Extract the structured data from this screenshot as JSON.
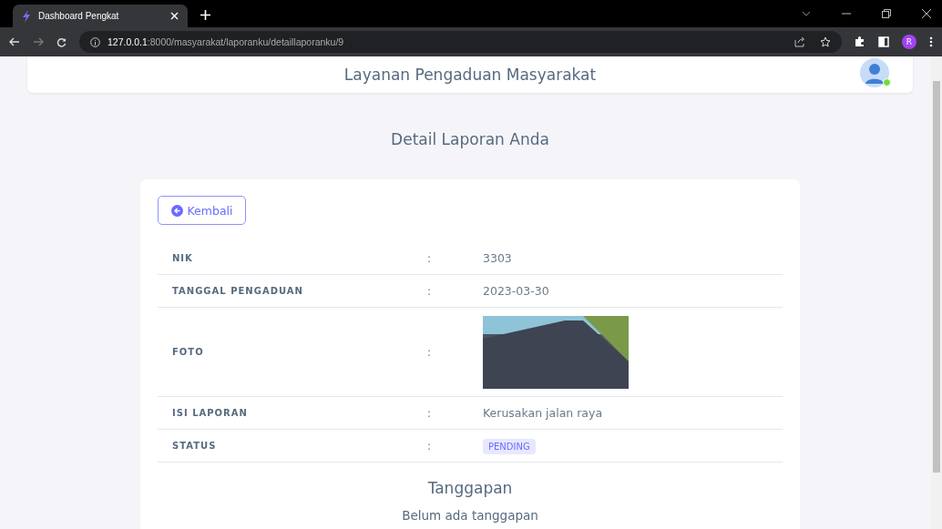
{
  "browser": {
    "tab_title": "Dashboard Pengkat",
    "url_host": "127.0.0.1",
    "url_path": ":8000/masyarakat/laporanku/detaillaporanku/9",
    "profile_initial": "R"
  },
  "header": {
    "title": "Layanan Pengaduan Masyarakat",
    "user_online": true
  },
  "page_title": "Detail Laporan Anda",
  "back_button": "Kembali",
  "rows": [
    {
      "kind": "text",
      "label": "NIK",
      "separator": ":",
      "value": "3303"
    },
    {
      "kind": "text",
      "label": "TANGGAL PENGADUAN",
      "separator": ":",
      "value": "2023-03-30"
    },
    {
      "kind": "photo",
      "label": "FOTO",
      "separator": ":"
    },
    {
      "kind": "text",
      "label": "ISI LAPORAN",
      "separator": ":",
      "value": "Kerusakan jalan raya"
    },
    {
      "kind": "badge",
      "label": "STATUS",
      "separator": ":",
      "value": "PENDING"
    }
  ],
  "response": {
    "title": "Tanggapan",
    "message": "Belum ada tanggapan"
  }
}
